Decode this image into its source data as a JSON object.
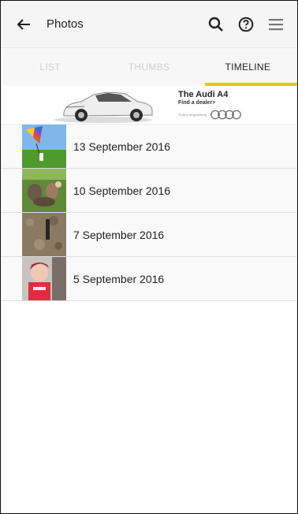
{
  "toolbar": {
    "title": "Photos",
    "icons": [
      "back-arrow-icon",
      "search-icon",
      "help-icon",
      "menu-icon"
    ]
  },
  "tabs": [
    {
      "label": "LIST",
      "active": false
    },
    {
      "label": "THUMBS",
      "active": false
    },
    {
      "label": "TIMELINE",
      "active": true
    }
  ],
  "ad": {
    "headline": "The Audi A4",
    "cta": "Find a dealer>",
    "tagline": "Truth in Engineering",
    "brand": "Audi"
  },
  "timeline": [
    {
      "date": "13 September 2016"
    },
    {
      "date": "10 September 2016"
    },
    {
      "date": "7 September 2016"
    },
    {
      "date": "5 September 2016"
    }
  ],
  "colors": {
    "accent": "#f5c200",
    "toolbar_bg": "#f5f5f5",
    "inactive_tab": "#cfcfcf"
  }
}
